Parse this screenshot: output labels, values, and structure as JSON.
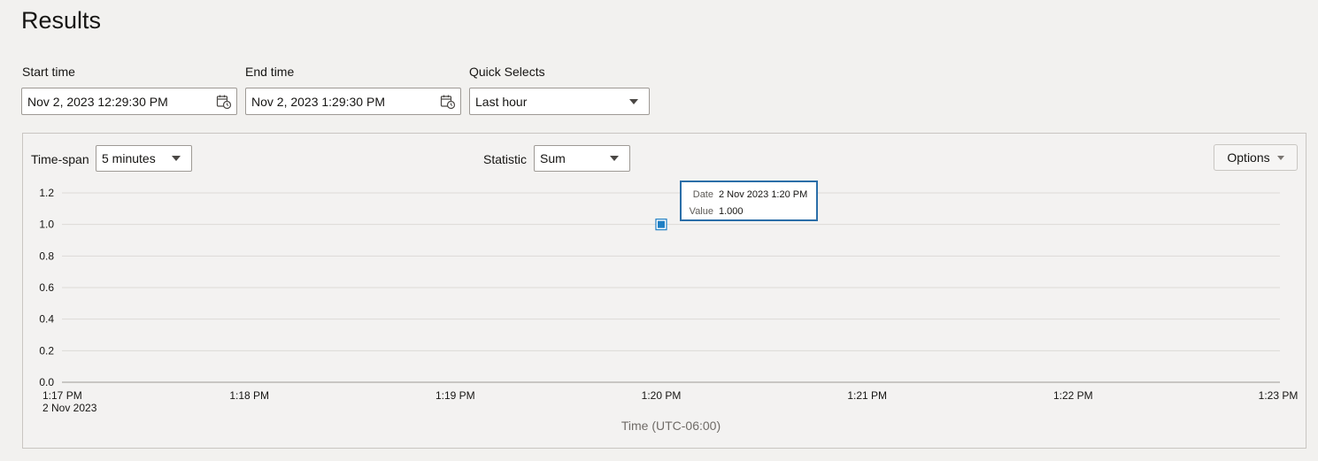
{
  "page": {
    "title": "Results"
  },
  "filters": {
    "start_time": {
      "label": "Start time",
      "value": "Nov 2, 2023 12:29:30 PM",
      "icon": "calendar-clock-icon"
    },
    "end_time": {
      "label": "End time",
      "value": "Nov 2, 2023 1:29:30 PM",
      "icon": "calendar-clock-icon"
    },
    "quick_selects": {
      "label": "Quick Selects",
      "value": "Last hour"
    }
  },
  "chart_controls": {
    "timespan": {
      "label": "Time-span",
      "value": "5 minutes"
    },
    "statistic": {
      "label": "Statistic",
      "value": "Sum"
    },
    "options_label": "Options"
  },
  "tooltip": {
    "date_key": "Date",
    "date_value": "2 Nov 2023 1:20 PM",
    "value_key": "Value",
    "value_value": "1.000"
  },
  "colors": {
    "point": "#1f7fc4",
    "tooltip_border": "#2b6ea8",
    "grid": "#dcdad7",
    "axis": "#9e9a95"
  },
  "chart_data": {
    "type": "scatter",
    "xlabel": "Time (UTC-06:00)",
    "ylabel": "",
    "x_ticks": [
      "1:17 PM",
      "1:18 PM",
      "1:19 PM",
      "1:20 PM",
      "1:21 PM",
      "1:22 PM",
      "1:23 PM"
    ],
    "x_first_tick_sublabel": "2 Nov 2023",
    "y_ticks": [
      "0.0",
      "0.2",
      "0.4",
      "0.6",
      "0.8",
      "1.0",
      "1.2"
    ],
    "ylim": [
      0,
      1.2
    ],
    "xlim": [
      "1:17 PM",
      "1:23 PM"
    ],
    "grid": true,
    "series": [
      {
        "points": [
          {
            "x": "1:20 PM",
            "y": 1.0
          }
        ]
      }
    ]
  }
}
